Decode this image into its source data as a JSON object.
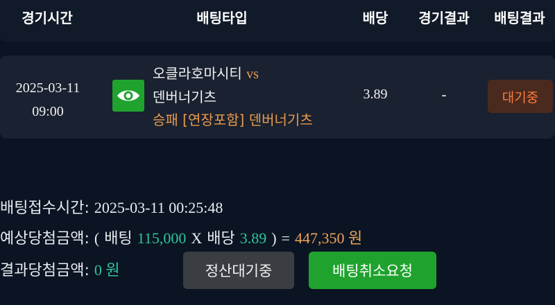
{
  "header": {
    "col_time": "경기시간",
    "col_type": "배팅타입",
    "col_odds": "배당",
    "col_game_result": "경기결과",
    "col_bet_result": "배팅결과"
  },
  "bet": {
    "date": "2025-03-11",
    "time": "09:00",
    "home_team": "오클라호마시티",
    "vs": "vs",
    "away_team": "덴버너기츠",
    "pick": "승패 [연장포함] 덴버너기츠",
    "odds": "3.89",
    "game_result": "-",
    "status": "대기중",
    "icon": "eye-icon"
  },
  "summary": {
    "received_label": "배팅접수시간:",
    "received_value": "2025-03-11 00:25:48",
    "expected_label": "예상당첨금액:",
    "open_paren": "(",
    "bet_word": "배팅",
    "bet_amount": "115,000",
    "times": "X",
    "odds_word": "배당",
    "odds_value": "3.89",
    "close_paren": ")",
    "equals": "=",
    "expected_amount": "447,350 원",
    "result_label": "결과당첨금액:",
    "result_amount": "0 원"
  },
  "buttons": {
    "pending_label": "정산대기중",
    "cancel_label": "배팅취소요청"
  },
  "colors": {
    "background": "#0b1422",
    "accent_green": "#1fa32e",
    "amount_green": "#2ec4a0",
    "accent_orange": "#f0a55a",
    "status_orange": "#ff7a3a"
  }
}
